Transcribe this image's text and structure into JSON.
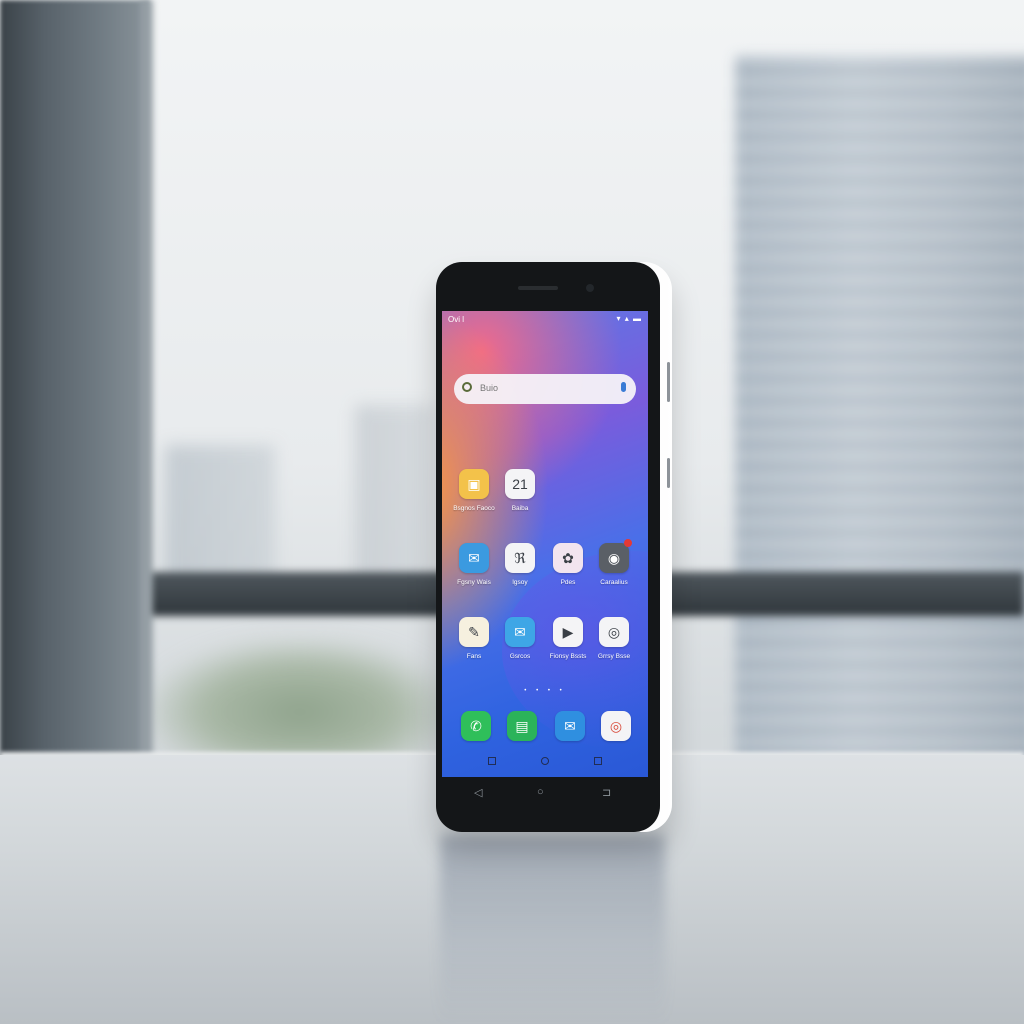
{
  "status_bar": {
    "carrier": "Ovi l",
    "icons": "▾ ▴ ▬"
  },
  "search": {
    "placeholder": "Buio"
  },
  "apps": [
    {
      "name": "photos-icon",
      "label": "Bsgnos Faoco",
      "glyph": "▣",
      "bg": "#f3c24a"
    },
    {
      "name": "calendar-icon",
      "label": "Baiba",
      "glyph": "21",
      "bg": "#f4f4f6"
    },
    {
      "name": "messenger-icon",
      "label": "Fgsny Wais",
      "glyph": "✉",
      "bg": "#3b9ae0"
    },
    {
      "name": "contacts-icon",
      "label": "lgsoy",
      "glyph": "ℜ",
      "bg": "#f4f4f6"
    },
    {
      "name": "gallery-icon",
      "label": "Pdes",
      "glyph": "✿",
      "bg": "#f2e4ef"
    },
    {
      "name": "camera-icon",
      "label": "Caraalius",
      "glyph": "◉",
      "bg": "#5a5f66"
    },
    {
      "name": "notes-icon",
      "label": "Fans",
      "glyph": "✎",
      "bg": "#f6f0df"
    },
    {
      "name": "mail-icon",
      "label": "Gsrcos",
      "glyph": "✉",
      "bg": "#3ea6e6"
    },
    {
      "name": "play-store-icon",
      "label": "Fionsy Bssts",
      "glyph": "▶",
      "bg": "#f4f4f6"
    },
    {
      "name": "chrome-icon",
      "label": "Grrsy Bsse",
      "glyph": "◎",
      "bg": "#f4f4f6"
    }
  ],
  "dock": [
    {
      "name": "phone-icon",
      "glyph": "✆",
      "bg": "#2fbf5a"
    },
    {
      "name": "messages-icon",
      "glyph": "▤",
      "bg": "#2bb35a"
    },
    {
      "name": "email-icon",
      "glyph": "✉",
      "bg": "#2f8fe0"
    },
    {
      "name": "browser-icon",
      "glyph": "◎",
      "bg": "#f4f4f6"
    }
  ],
  "page_dots": "• • • •",
  "hardware_nav": {
    "back": "◁",
    "home": "○",
    "recents": "⊐"
  },
  "colors": {
    "accent": "#2f63e0",
    "frame": "#141618",
    "badge": "#e53935"
  }
}
